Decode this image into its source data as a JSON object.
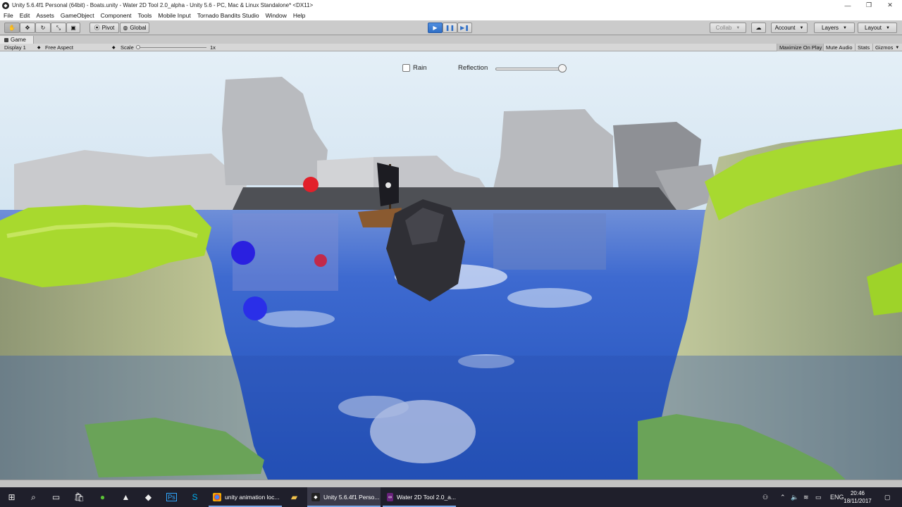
{
  "window": {
    "title": "Unity 5.6.4f1 Personal (64bit) - Boats.unity - Water 2D Tool 2.0_alpha - Unity 5.6 - PC, Mac & Linux Standalone* <DX11>",
    "minimize": "—",
    "restore": "❐",
    "close": "✕"
  },
  "menu": [
    "File",
    "Edit",
    "Assets",
    "GameObject",
    "Component",
    "Tools",
    "Mobile Input",
    "Tornado Bandits Studio",
    "Window",
    "Help"
  ],
  "toolbar": {
    "tools": [
      "hand-icon",
      "move-icon",
      "rotate-icon",
      "scale-icon",
      "rect-icon"
    ],
    "pivot_label": "Pivot",
    "global_label": "Global",
    "playback": [
      "play-icon",
      "pause-icon",
      "step-icon"
    ],
    "collab_label": "Collab",
    "account_label": "Account",
    "layers_label": "Layers",
    "layout_label": "Layout"
  },
  "game_tab": {
    "label": "Game",
    "display": "Display 1",
    "aspect": "Free Aspect",
    "scale_label": "Scale",
    "scale_value": "1x",
    "maximize_on_play": "Maximize On Play",
    "mute_audio": "Mute Audio",
    "stats": "Stats",
    "gizmos": "Gizmos"
  },
  "game_ui": {
    "rain_label": "Rain",
    "rain_checked": false,
    "reflection_label": "Reflection",
    "reflection_value": 0.95
  },
  "taskbar": {
    "apps": [
      {
        "label": "unity animation loc...",
        "icon": "chrome-icon",
        "active": false
      },
      {
        "label": "Unity 5.6.4f1 Perso...",
        "icon": "unity-icon",
        "active": true
      },
      {
        "label": "Water 2D Tool 2.0_a...",
        "icon": "visual-studio-icon",
        "active": false
      }
    ],
    "language": "ENG",
    "time": "20:46",
    "date": "18/11/2017"
  },
  "colors": {
    "water": "#2d5fc2",
    "grass": "#a6d82e",
    "rock": "#b7b9bd",
    "play_accent": "#3a7bd5",
    "taskbar": "#1f1f2b"
  }
}
